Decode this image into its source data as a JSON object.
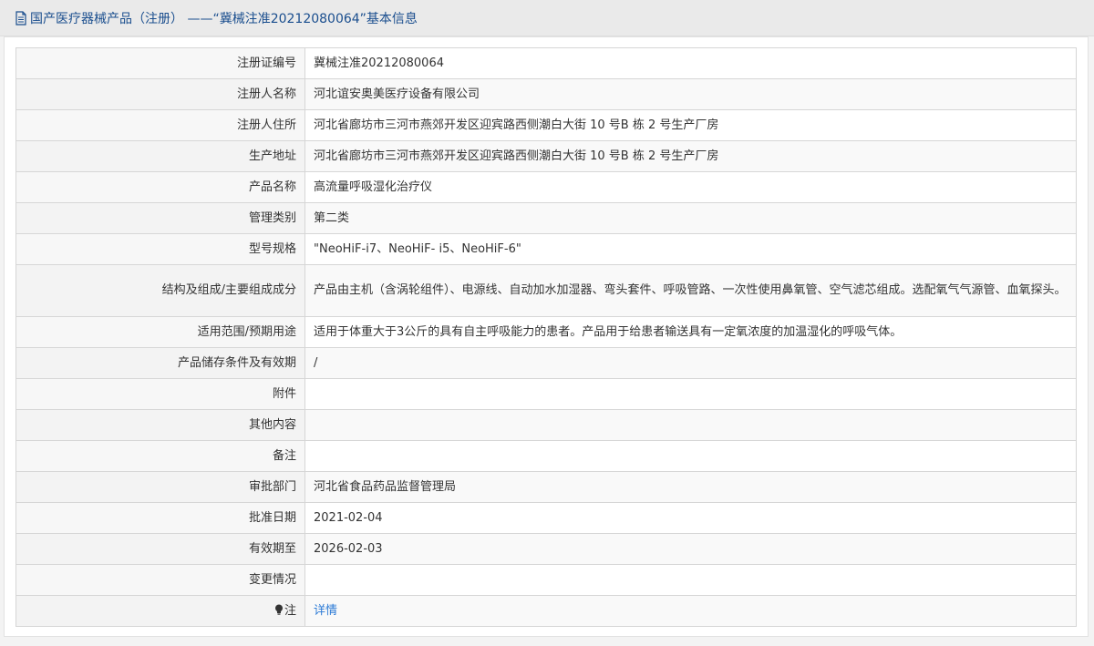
{
  "header": {
    "title": "国产医疗器械产品（注册） ——“冀械注准20212080064”基本信息"
  },
  "rows": [
    {
      "label": "注册证编号",
      "value": "冀械注准20212080064"
    },
    {
      "label": "注册人名称",
      "value": "河北谊安奥美医疗设备有限公司"
    },
    {
      "label": "注册人住所",
      "value": "河北省廊坊市三河市燕郊开发区迎宾路西侧潮白大街 10 号B 栋 2 号生产厂房"
    },
    {
      "label": "生产地址",
      "value": "河北省廊坊市三河市燕郊开发区迎宾路西侧潮白大街 10 号B 栋 2 号生产厂房"
    },
    {
      "label": "产品名称",
      "value": "高流量呼吸湿化治疗仪"
    },
    {
      "label": "管理类别",
      "value": "第二类"
    },
    {
      "label": "型号规格",
      "value": "\"NeoHiF-i7、NeoHiF- i5、NeoHiF-6\""
    },
    {
      "label": "结构及组成/主要组成成分",
      "value": "产品由主机（含涡轮组件）、电源线、自动加水加湿器、弯头套件、呼吸管路、一次性使用鼻氧管、空气滤芯组成。选配氧气气源管、血氧探头。"
    },
    {
      "label": "适用范围/预期用途",
      "value": "适用于体重大于3公斤的具有自主呼吸能力的患者。产品用于给患者输送具有一定氧浓度的加温湿化的呼吸气体。"
    },
    {
      "label": "产品储存条件及有效期",
      "value": "/"
    },
    {
      "label": "附件",
      "value": ""
    },
    {
      "label": "其他内容",
      "value": ""
    },
    {
      "label": "备注",
      "value": ""
    },
    {
      "label": "审批部门",
      "value": "河北省食品药品监督管理局"
    },
    {
      "label": "批准日期",
      "value": "2021-02-04"
    },
    {
      "label": "有效期至",
      "value": "2026-02-03"
    },
    {
      "label": "变更情况",
      "value": ""
    }
  ],
  "note": {
    "label": "注",
    "link": "详情",
    "icon": "lightbulb-icon"
  },
  "colors": {
    "header_title": "#1a4e8e",
    "link": "#2b7ad6",
    "border": "#d6d6d6"
  }
}
